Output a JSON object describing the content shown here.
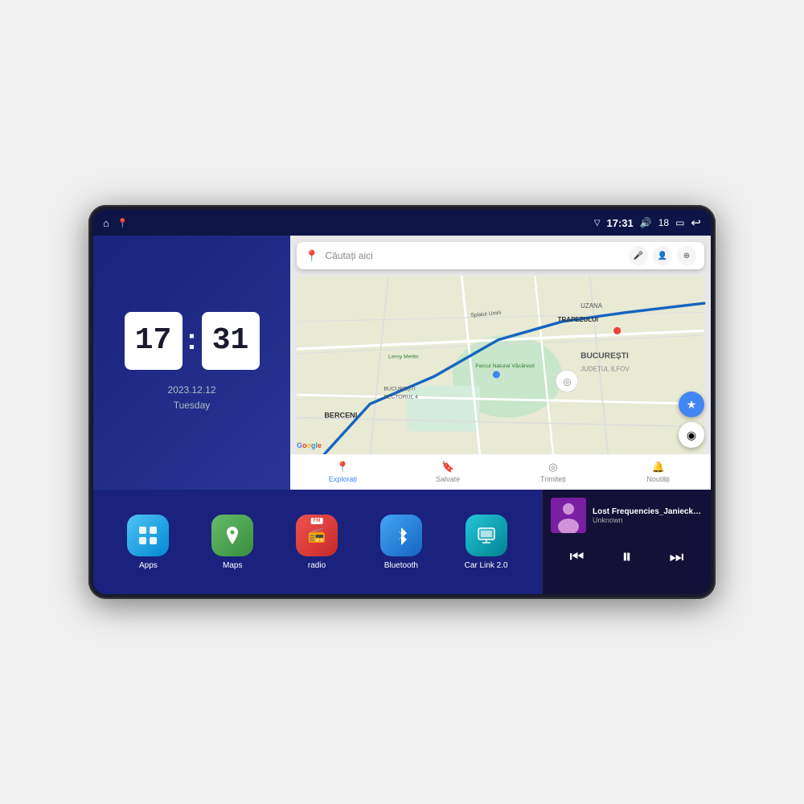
{
  "device": {
    "status_bar": {
      "left_icons": [
        "home",
        "maps-pin"
      ],
      "time": "17:31",
      "signal_icon": "▽",
      "volume_icon": "🔊",
      "battery_level": "18",
      "battery_icon": "▭",
      "back_icon": "↩"
    },
    "clock": {
      "hour": "17",
      "minute": "31",
      "date": "2023.12.12",
      "day": "Tuesday"
    },
    "map": {
      "search_placeholder": "Căutați aici",
      "nav_items": [
        {
          "label": "Explorați",
          "icon": "📍",
          "active": true
        },
        {
          "label": "Salvate",
          "icon": "🔖",
          "active": false
        },
        {
          "label": "Trimiteți",
          "icon": "◎",
          "active": false
        },
        {
          "label": "Noutăți",
          "icon": "🔔",
          "active": false
        }
      ],
      "labels": {
        "uzana": "UZANA",
        "trapezului": "TRAPEZULUI",
        "berceni": "BERCENI",
        "bucuresti": "BUCUREȘTI",
        "judet": "JUDEȚUL ILFOV",
        "leroy": "Leroy Merlin",
        "parc": "Parcul Natural Văcărești",
        "sector4": "BUCUREȘTI\nSECTORUL 4",
        "splai": "Splaiul Unirii"
      }
    },
    "apps": [
      {
        "id": "apps",
        "label": "Apps",
        "icon": "⊞",
        "color_class": "apps-icon"
      },
      {
        "id": "maps",
        "label": "Maps",
        "icon": "📍",
        "color_class": "maps-icon"
      },
      {
        "id": "radio",
        "label": "radio",
        "icon": "📻",
        "color_class": "radio-icon",
        "badge": "FM"
      },
      {
        "id": "bluetooth",
        "label": "Bluetooth",
        "icon": "⚡",
        "color_class": "bluetooth-icon"
      },
      {
        "id": "carlink",
        "label": "Car Link 2.0",
        "icon": "📱",
        "color_class": "carlink-icon"
      }
    ],
    "music": {
      "title": "Lost Frequencies_Janieck Devy-...",
      "artist": "Unknown",
      "controls": {
        "prev": "⏮",
        "play_pause": "⏸",
        "next": "⏭"
      }
    }
  }
}
